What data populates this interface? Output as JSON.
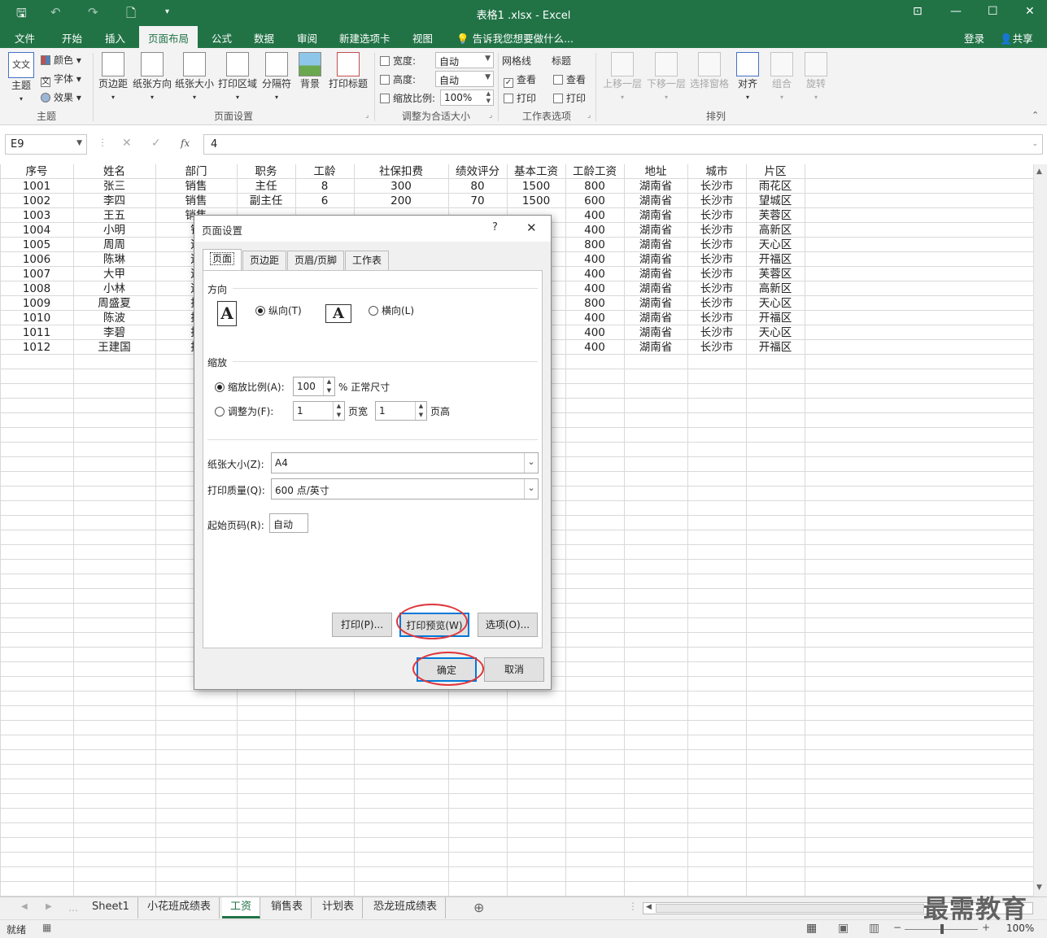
{
  "window": {
    "title": "表格1 .xlsx - Excel"
  },
  "menu_tabs": [
    "文件",
    "开始",
    "插入",
    "页面布局",
    "公式",
    "数据",
    "审阅",
    "新建选项卡",
    "视图"
  ],
  "active_tab": "页面布局",
  "tell_me": "告诉我您想要做什么...",
  "account": {
    "login": "登录",
    "share": "共享"
  },
  "ribbon": {
    "theme": {
      "button": "主题",
      "colors": "颜色",
      "fonts": "字体",
      "effects": "效果",
      "group": "主题"
    },
    "page_setup": {
      "margins": "页边距",
      "orientation": "纸张方向",
      "size": "纸张大小",
      "print_area": "打印区域",
      "breaks": "分隔符",
      "background": "背景",
      "print_titles": "打印标题",
      "group": "页面设置"
    },
    "scale": {
      "width_label": "宽度:",
      "width_value": "自动",
      "height_label": "高度:",
      "height_value": "自动",
      "scale_label": "缩放比例:",
      "scale_value": "100%",
      "group": "调整为合适大小"
    },
    "sheet_options": {
      "gridlines": "网格线",
      "headings": "标题",
      "view": "查看",
      "print": "打印",
      "group": "工作表选项"
    },
    "arrange": {
      "forward": "上移一层",
      "backward": "下移一层",
      "selection_pane": "选择窗格",
      "align": "对齐",
      "group_btn": "组合",
      "rotate": "旋转",
      "group": "排列"
    }
  },
  "formula_bar": {
    "name_box": "E9",
    "fx": "fx",
    "value": "4"
  },
  "sheet": {
    "headers": [
      "序号",
      "姓名",
      "部门",
      "职务",
      "工龄",
      "社保扣费",
      "绩效评分",
      "基本工资",
      "工龄工资",
      "地址",
      "城市",
      "片区"
    ],
    "rows": [
      [
        "1001",
        "张三",
        "销售",
        "主任",
        "8",
        "300",
        "80",
        "1500",
        "800",
        "湖南省",
        "长沙市",
        "雨花区"
      ],
      [
        "1002",
        "李四",
        "销售",
        "副主任",
        "6",
        "200",
        "70",
        "1500",
        "600",
        "湖南省",
        "长沙市",
        "望城区"
      ],
      [
        "1003",
        "王五",
        "销售",
        "",
        "",
        "",
        "",
        "",
        "400",
        "湖南省",
        "长沙市",
        "芙蓉区"
      ],
      [
        "1004",
        "小明",
        "销",
        "",
        "",
        "",
        "",
        "",
        "400",
        "湖南省",
        "长沙市",
        "高新区"
      ],
      [
        "1005",
        "周周",
        "运",
        "",
        "",
        "",
        "",
        "",
        "800",
        "湖南省",
        "长沙市",
        "天心区"
      ],
      [
        "1006",
        "陈琳",
        "运",
        "",
        "",
        "",
        "",
        "",
        "400",
        "湖南省",
        "长沙市",
        "开福区"
      ],
      [
        "1007",
        "大甲",
        "运",
        "",
        "",
        "",
        "",
        "",
        "400",
        "湖南省",
        "长沙市",
        "芙蓉区"
      ],
      [
        "1008",
        "小林",
        "运",
        "",
        "",
        "",
        "",
        "",
        "400",
        "湖南省",
        "长沙市",
        "高新区"
      ],
      [
        "1009",
        "周盛夏",
        "技",
        "",
        "",
        "",
        "",
        "",
        "800",
        "湖南省",
        "长沙市",
        "天心区"
      ],
      [
        "1010",
        "陈波",
        "技",
        "",
        "",
        "",
        "",
        "",
        "400",
        "湖南省",
        "长沙市",
        "开福区"
      ],
      [
        "1011",
        "李碧",
        "技",
        "",
        "",
        "",
        "",
        "",
        "400",
        "湖南省",
        "长沙市",
        "天心区"
      ],
      [
        "1012",
        "王建国",
        "技",
        "",
        "",
        "",
        "",
        "",
        "400",
        "湖南省",
        "长沙市",
        "开福区"
      ]
    ]
  },
  "sheet_tabs": [
    "Sheet1",
    "小花班成绩表",
    "工资",
    "销售表",
    "计划表",
    "恐龙班成绩表"
  ],
  "active_sheet": "工资",
  "status": {
    "ready": "就绪",
    "zoom": "100%"
  },
  "watermark": "最需教育",
  "dialog": {
    "title": "页面设置",
    "help": "?",
    "close": "✕",
    "tabs": [
      "页面",
      "页边距",
      "页眉/页脚",
      "工作表"
    ],
    "orientation": {
      "label": "方向",
      "portrait": "纵向(T)",
      "landscape": "横向(L)"
    },
    "scaling": {
      "label": "缩放",
      "adjust_to": "缩放比例(A):",
      "adjust_value": "100",
      "adjust_suffix": "% 正常尺寸",
      "fit_to": "调整为(F):",
      "fit_wide": "1",
      "wide_label": "页宽",
      "fit_tall": "1",
      "tall_label": "页高"
    },
    "paper_size": {
      "label": "纸张大小(Z):",
      "value": "A4"
    },
    "print_quality": {
      "label": "打印质量(Q):",
      "value": "600 点/英寸"
    },
    "first_page": {
      "label": "起始页码(R):",
      "value": "自动"
    },
    "buttons": {
      "print": "打印(P)...",
      "preview": "打印预览(W)",
      "options": "选项(O)...",
      "ok": "确定",
      "cancel": "取消"
    }
  }
}
